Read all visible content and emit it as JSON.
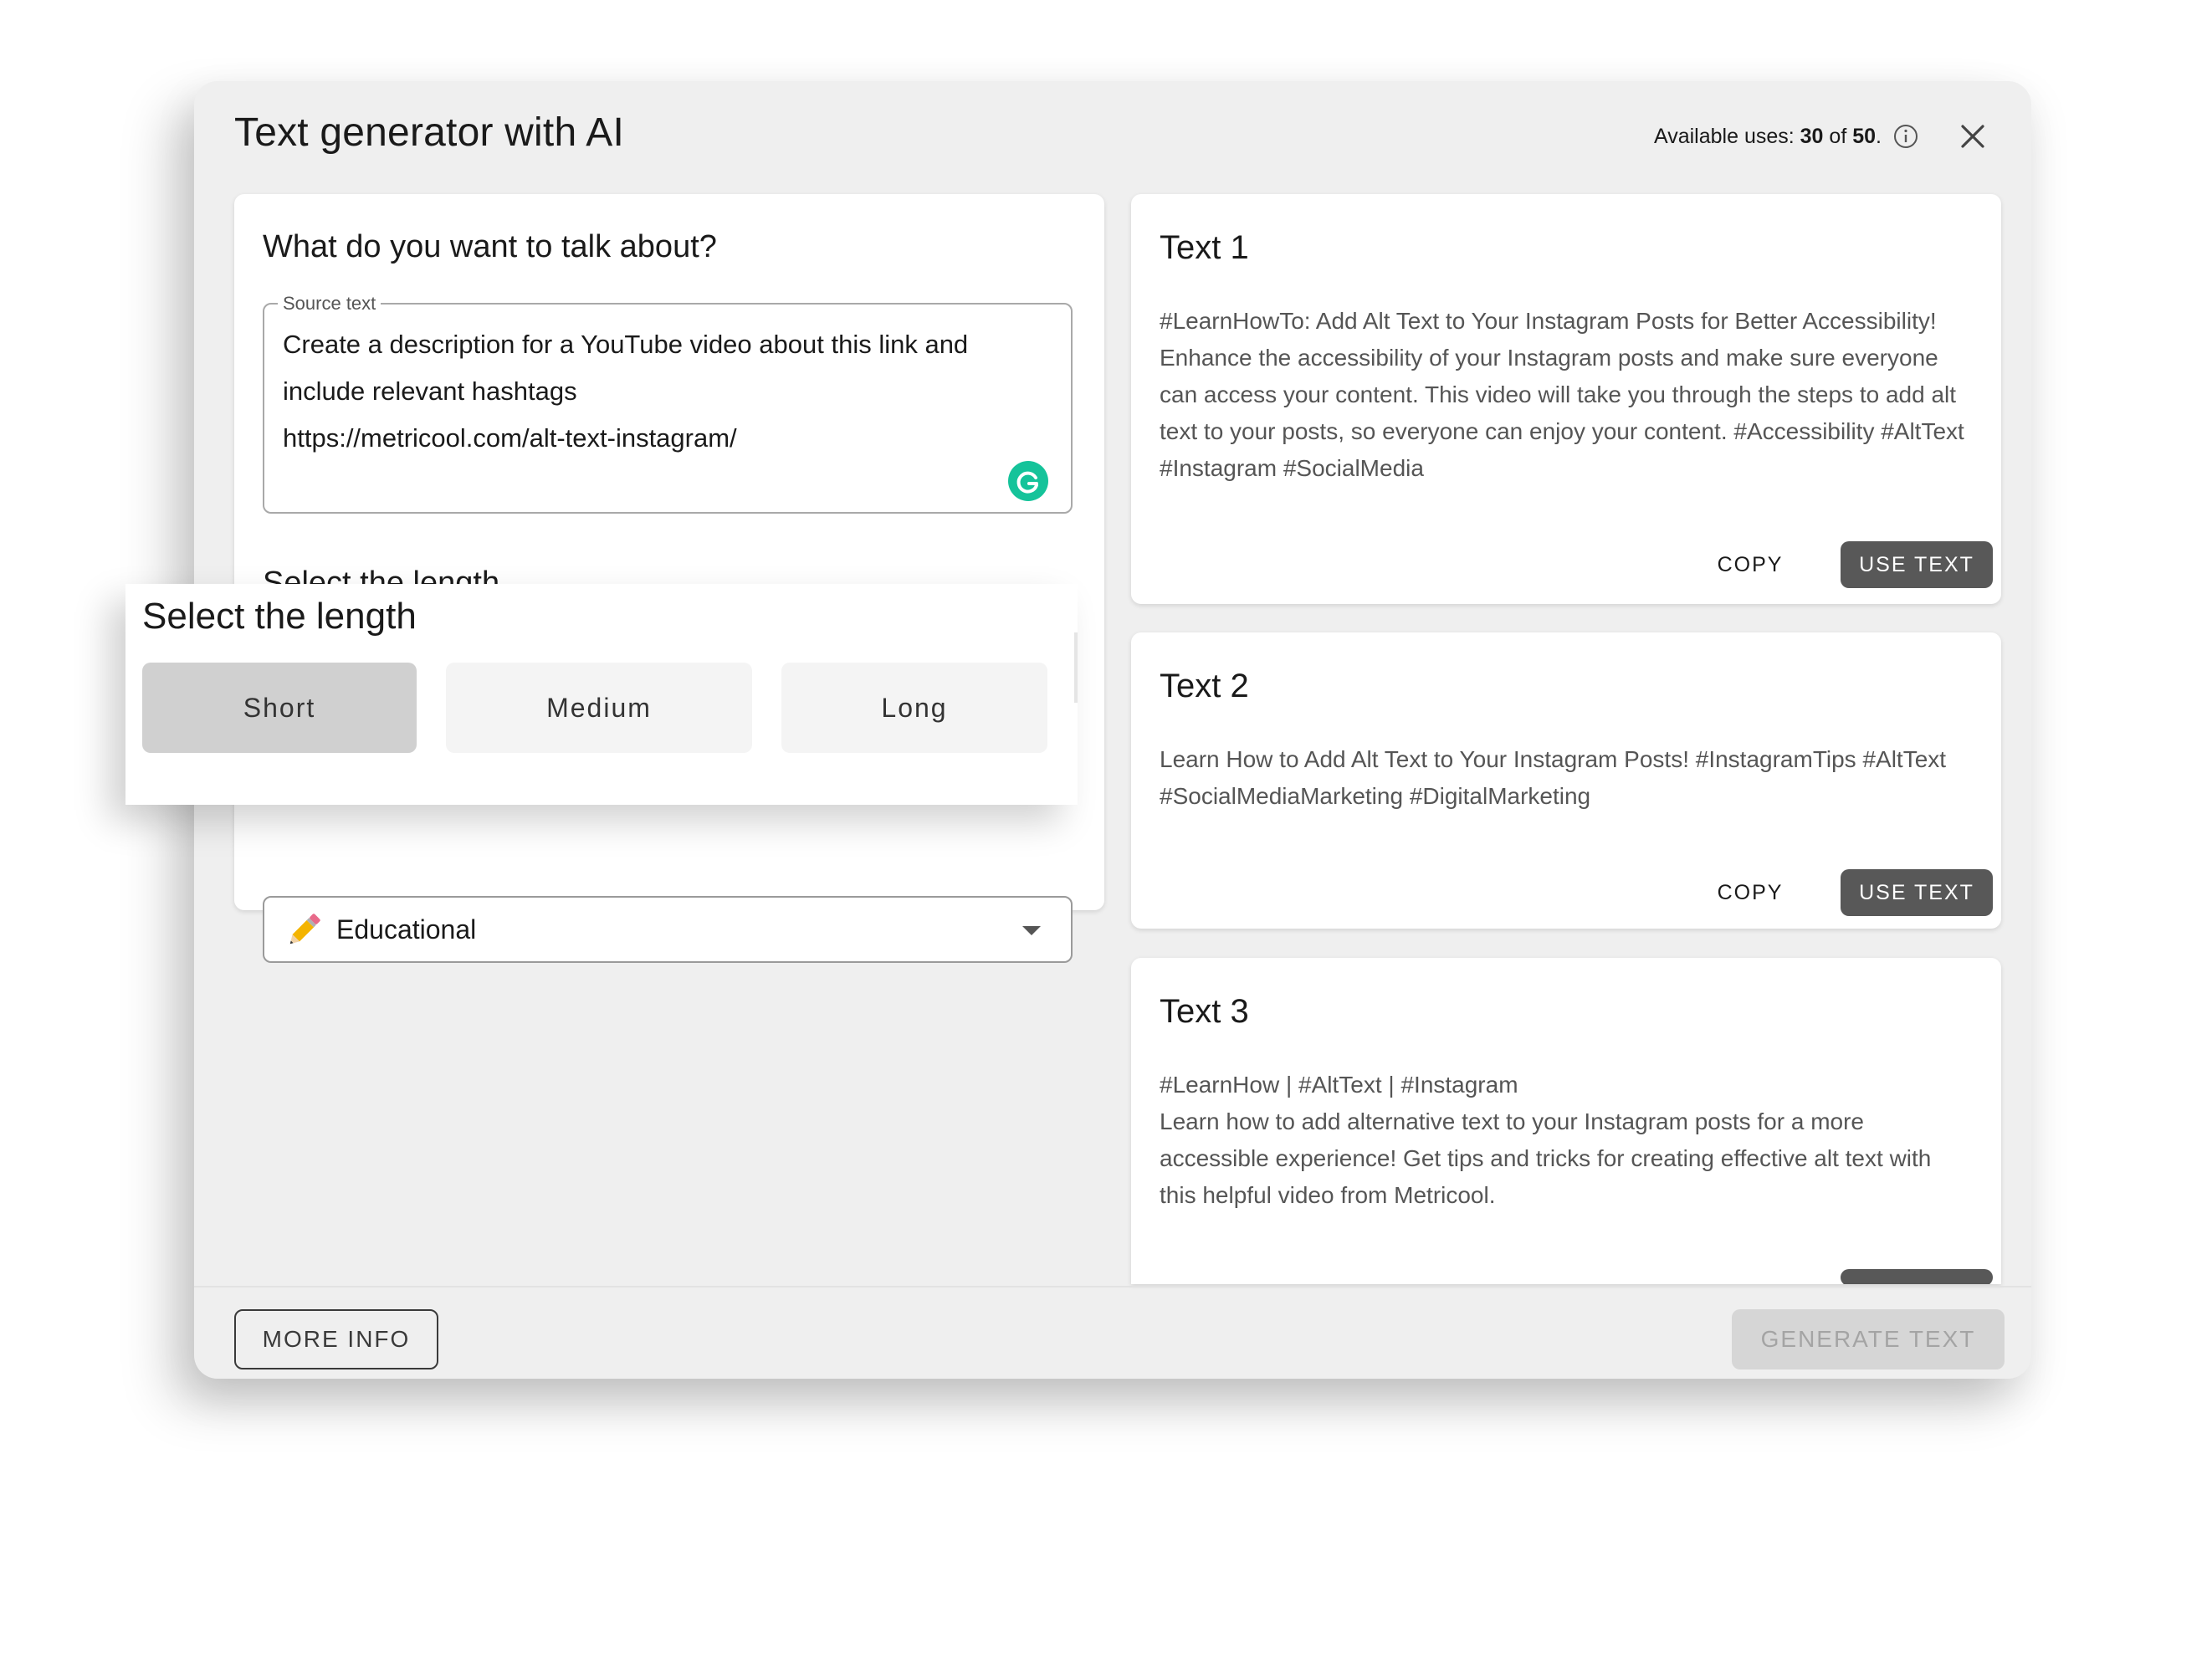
{
  "modal": {
    "title": "Text generator with AI",
    "uses_prefix": "Available uses: ",
    "uses_used": "30",
    "uses_mid": " of ",
    "uses_total": "50",
    "uses_suffix": "."
  },
  "left_panel": {
    "heading": "What do you want to talk about?",
    "source_label": "Source text",
    "source_value": "Create a description for a YouTube video about this link and\ninclude relevant hashtags\nhttps://metricool.com/alt-text-instagram/",
    "length_heading": "Select the length",
    "tone_value": "Educational",
    "tone_emoji": "✏️"
  },
  "length_selector": {
    "title": "Select the length",
    "options": [
      "Short",
      "Medium",
      "Long"
    ],
    "selected": "Short"
  },
  "results": [
    {
      "title": "Text 1",
      "body": "#LearnHowTo: Add Alt Text to Your Instagram Posts for Better Accessibility!\nEnhance the accessibility of your Instagram posts and make sure everyone\ncan access your content. This video will take you through the steps to add alt\ntext to your posts, so everyone can enjoy your content. #Accessibility #AltText\n#Instagram #SocialMedia",
      "copy_label": "COPY",
      "use_label": "USE TEXT"
    },
    {
      "title": "Text 2",
      "body": "Learn How to Add Alt Text to Your Instagram Posts! #InstagramTips #AltText\n#SocialMediaMarketing #DigitalMarketing",
      "copy_label": "COPY",
      "use_label": "USE TEXT"
    },
    {
      "title": "Text 3",
      "body": "#LearnHow | #AltText | #Instagram\nLearn how to add alternative text to your Instagram posts for a more\naccessible experience! Get tips and tricks for creating effective alt text with\nthis helpful video from Metricool."
    }
  ],
  "footer": {
    "more_info": "MORE INFO",
    "generate": "GENERATE TEXT"
  },
  "colors": {
    "primary_button": "#585858",
    "grammarly": "#15c39a",
    "disabled_button": "#d6d6d6"
  }
}
